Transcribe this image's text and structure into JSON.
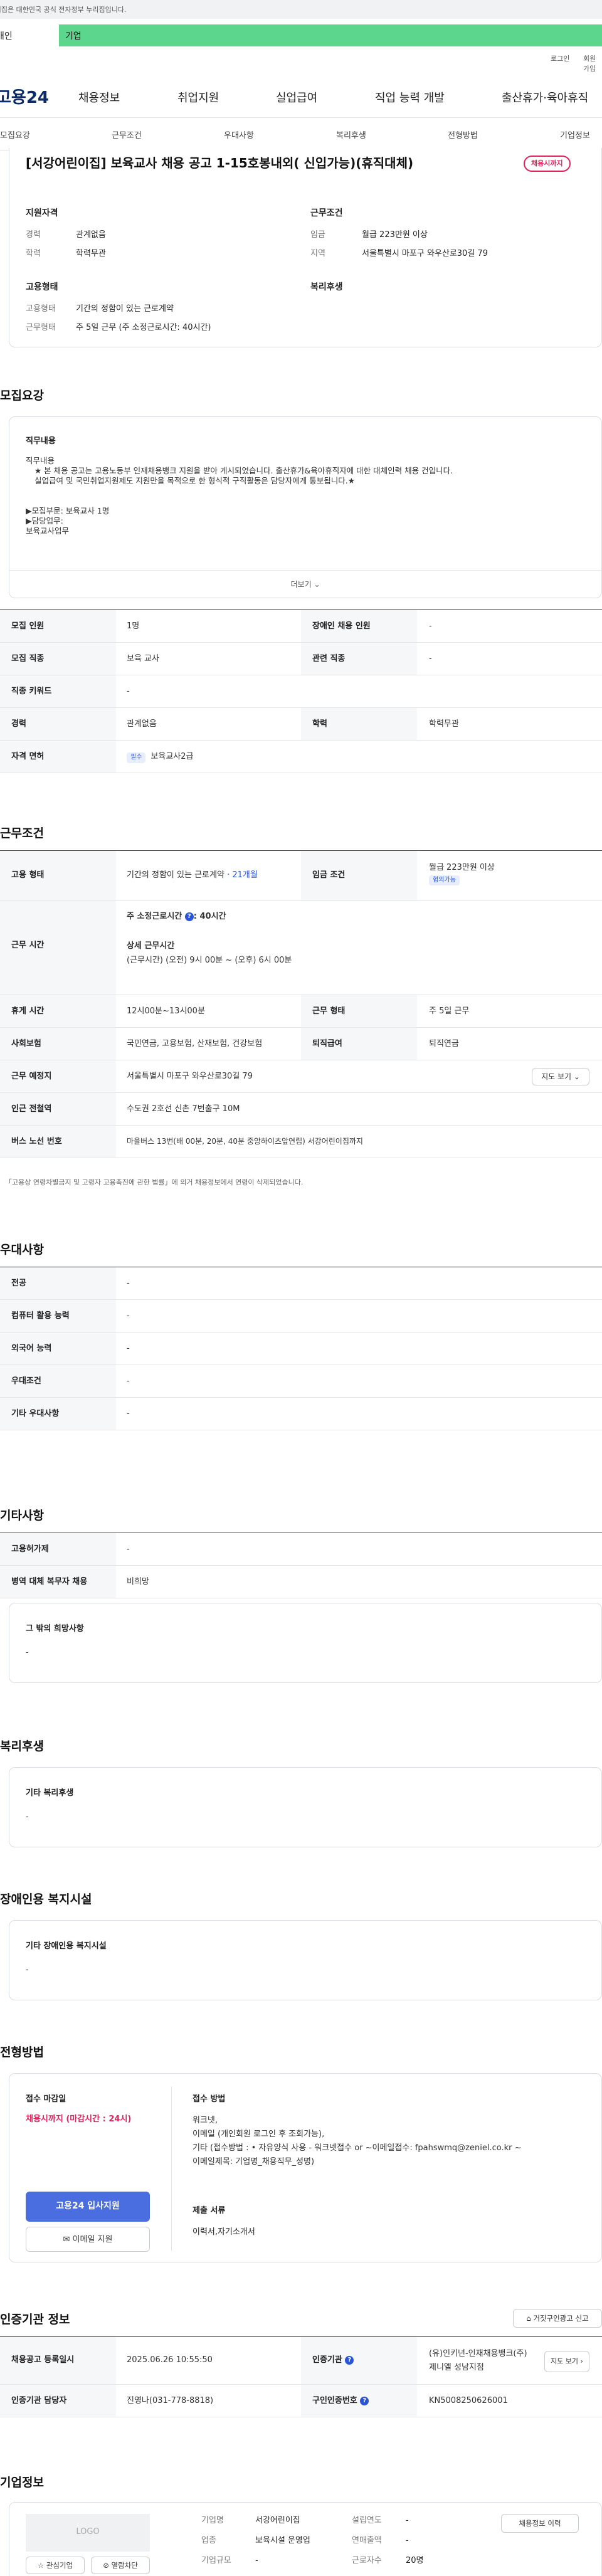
{
  "gov_banner": "이 누리집은 대한민국 공식 전자정부 누리집입니다.",
  "audience_tabs": [
    "개인",
    "기업"
  ],
  "top_menu": [
    "로그인",
    "회원가입"
  ],
  "logo": "고용24",
  "gnb": [
    "채용정보",
    "취업지원",
    "실업급여",
    "직업 능력 개발",
    "출산휴가·육아휴직"
  ],
  "snb": [
    "모집요강",
    "근무조건",
    "우대사항",
    "복리후생",
    "전형방법",
    "기업정보"
  ],
  "job": {
    "title": "[서강어린이집] 보육교사 채용 공고 1-15호봉내외( 신입가능)(휴직대체)",
    "status_badge": "채용시까지",
    "qual_heading": "지원자격",
    "career_label": "경력",
    "career_value": "관계없음",
    "edu_label": "학력",
    "edu_value": "학력무관",
    "cond_heading": "근무조건",
    "wage_label": "임금",
    "wage_value": "월급 223만원 이상",
    "region_label": "지역",
    "region_value": "서울특별시 마포구 와우산로30길 79",
    "emp_heading": "고용형태",
    "emp_type_label": "고용형태",
    "emp_type_value": "기간의 정함이 있는 근로계약",
    "work_form_label": "근무형태",
    "work_form_value": "주 5일 근무 (주 소정근로시간: 40시간)",
    "welfare_heading": "복리후생"
  },
  "recruit": {
    "heading": "모집요강",
    "box_title": "직무내용",
    "lines": [
      "직무내용",
      "★ 본 채용 공고는 고용노동부 인재채용뱅크 지원을 받아 게시되었습니다. 출산휴가&육아휴직자에 대한 대체인력 채용 건입니다.",
      "실업급여 및 국민취업지원제도 지원만을 목적으로 한 형식적 구직활동은 담당자에게 통보됩니다.★",
      "",
      "▶모집부문: 보육교사 1명",
      "▶담당업무:",
      "보육교사업무"
    ],
    "more": "더보기",
    "rows": [
      {
        "th1": "모집 인원",
        "td1": "1명",
        "th2": "장애인 채용 인원",
        "td2": "-"
      },
      {
        "th1": "모집 직종",
        "td1": "보육 교사",
        "th2": "관련 직종",
        "td2": "-"
      },
      {
        "th1": "직종 키워드",
        "td1": "-",
        "th2": "",
        "td2": ""
      },
      {
        "th1": "경력",
        "td1": "관계없음",
        "th2": "학력",
        "td2": "학력무관"
      },
      {
        "th1": "자격 면허",
        "td1": "보육교사2급",
        "th2": "",
        "td2": ""
      }
    ],
    "required_tag": "필수"
  },
  "work": {
    "heading": "근무조건",
    "emp_label": "고용 형태",
    "emp_value": "기간의 정함이 있는 근로계약",
    "emp_months": "· 21개월",
    "wage_label": "임금 조건",
    "wage_value": "월급 223만원 이상",
    "wage_tag": "협의가능",
    "hours_label": "근무 시간",
    "hours_title": "주 소정근로시간",
    "hours_value": ": 40시간",
    "hours_detail_title": "상세 근무시간",
    "hours_detail": "(근무시간) (오전) 9시 00분 ~ (오후) 6시 00분",
    "rows": [
      {
        "th1": "휴게 시간",
        "td1": "12시00분~13시00분",
        "th2": "근무 형태",
        "td2": "주 5일 근무"
      },
      {
        "th1": "사회보험",
        "td1": "국민연금, 고용보험, 산재보험, 건강보험",
        "th2": "퇴직급여",
        "td2": "퇴직연금"
      }
    ],
    "place_label": "근무 예정지",
    "place_value": "서울특별시 마포구 와우산로30길 79",
    "map_btn": "지도 보기",
    "subway_label": "인근 전철역",
    "subway_value": "수도권 2호선 신촌 7번출구 10M",
    "bus_label": "버스 노선 번호",
    "bus_value": "마을버스 13번(배 00분, 20분, 40분 중앙하이츠앞연립) 서강어린이집까지",
    "note": "「고용상 연령차별금지 및 고령자 고용촉진에 관한 법률」에 의거 채용정보에서 연령이 삭제되었습니다."
  },
  "pref": {
    "heading": "우대사항",
    "rows": [
      {
        "label": "전공",
        "value": "-"
      },
      {
        "label": "컴퓨터 활용 능력",
        "value": "-"
      },
      {
        "label": "외국어 능력",
        "value": "-"
      },
      {
        "label": "우대조건",
        "value": "-"
      },
      {
        "label": "기타 우대사항",
        "value": "-"
      }
    ]
  },
  "etc": {
    "heading": "기타사항",
    "rows": [
      {
        "label": "고용허가제",
        "value": "-"
      },
      {
        "label": "병역 대체 복무자 채용",
        "value": "비희망"
      }
    ],
    "box_title": "그 밖의 희망사항",
    "box_value": "-"
  },
  "welfare": {
    "heading": "복리후생",
    "box_title": "기타 복리후생",
    "box_value": "-"
  },
  "disability": {
    "heading": "장애인용 복지시설",
    "box_title": "기타 장애인용 복지시설",
    "box_value": "-"
  },
  "selection": {
    "heading": "전형방법",
    "deadline_label": "접수 마감일",
    "deadline_value": "채용시까지 (마감시간 : 24시)",
    "apply_btn": "고용24 입사지원",
    "email_btn": "이메일 지원",
    "method_label": "접수 방법",
    "methods": [
      "워크넷,",
      "이메일 (개인회원 로그인 후 조회가능),",
      "기타 (접수방법 : • 자유양식 사용 - 워크넷접수 or ~이메일접수:  fpahswmq@zeniel.co.kr  ~",
      "이메일제목: 기업명_채용직무_성명)"
    ],
    "docs_label": "제출 서류",
    "docs_value": "이력서,자기소개서"
  },
  "cert": {
    "heading": "인증기관 정보",
    "report_btn": "거짓구인광고 신고",
    "row1": {
      "th1": "채용공고 등록일시",
      "td1": "2025.06.26 10:55:50",
      "th2": "인증기관",
      "td2a": "(유)인키넌-인재채용뱅크(주)",
      "td2b": "제니엘 성남지점",
      "btn": "지도 보기"
    },
    "row2": {
      "th1": "인증기관 담당자",
      "td1": "진영나(031-778-8818)",
      "th2": "구인인증번호",
      "td2": "KN5008250626001"
    }
  },
  "company": {
    "heading": "기업정보",
    "logo": "LOGO",
    "jobs_btn": "채용정보 이력",
    "interest_btn": "관심기업",
    "block_btn": "열람차단",
    "fields": [
      {
        "label": "기업명",
        "value": "서강어린이집",
        "label2": "설립연도",
        "value2": "-"
      },
      {
        "label": "업종",
        "value": "보육시설 운영업",
        "label2": "연매출액",
        "value2": "-"
      },
      {
        "label": "기업규모",
        "value": "-",
        "label2": "근로자수",
        "value2": "20명"
      }
    ]
  },
  "colors": {
    "accent": "#2a55d6",
    "green": "#5bd68c",
    "red": "#e0245e"
  }
}
